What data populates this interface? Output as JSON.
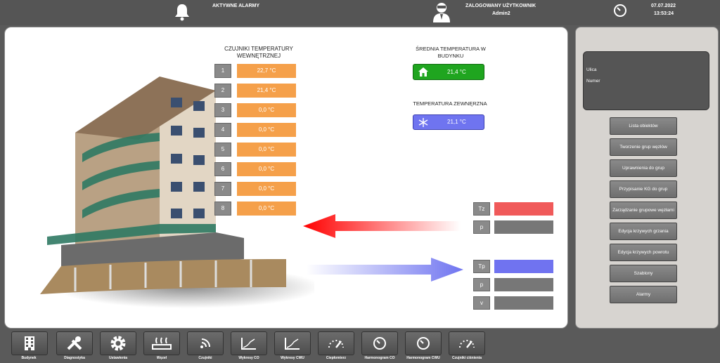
{
  "header": {
    "alarms_label": "AKTYWNE ALARMY",
    "user_title": "ZALOGOWANY UŻYTKOWNIK",
    "user_name": "Admin2",
    "date": "07.07.2022",
    "time": "13:53:24"
  },
  "sensors": {
    "title": "CZUJNIKI TEMPERATURY WEWNĘTRZNEJ",
    "items": [
      {
        "num": "1",
        "value": "22,7 °C"
      },
      {
        "num": "2",
        "value": "21,4 °C"
      },
      {
        "num": "3",
        "value": "0,0 °C"
      },
      {
        "num": "4",
        "value": "0,0 °C"
      },
      {
        "num": "5",
        "value": "0,0 °C"
      },
      {
        "num": "6",
        "value": "0,0 °C"
      },
      {
        "num": "7",
        "value": "0,0 °C"
      },
      {
        "num": "8",
        "value": "0,0 °C"
      }
    ]
  },
  "average": {
    "title": "ŚREDNIA TEMPERATURA W BUDYNKU",
    "value": "21,4 °C",
    "color": "#1fa51f"
  },
  "external": {
    "title": "TEMPERATURA ZEWNĘRZNA",
    "value": "21,1 °C",
    "color": "#6f74f0"
  },
  "supply": {
    "tz": {
      "label": "Tz",
      "color": "#f05a5a"
    },
    "p": {
      "label": "p",
      "color": "#777777"
    }
  },
  "return": {
    "tp": {
      "label": "Tp",
      "color": "#7073f0"
    },
    "p": {
      "label": "p",
      "color": "#777777"
    },
    "v": {
      "label": "v",
      "color": "#777777"
    }
  },
  "sidebar": {
    "street_label": "Ulica",
    "number_label": "Numer",
    "buttons": [
      "Lista obiektów",
      "Tworzenie grup węzłów",
      "Uprawnienia do grup",
      "Przypisanie KG do grup",
      "Zarządzanie grupowe węzłami",
      "Edycja krzywych grzania",
      "Edycja krzywych powrotu",
      "Szablony",
      "Alarmy"
    ]
  },
  "nav": [
    {
      "label": "Budynek",
      "icon": "building-icon"
    },
    {
      "label": "Diagnostyka",
      "icon": "tools-icon"
    },
    {
      "label": "Ustawienia",
      "icon": "gear-icon"
    },
    {
      "label": "Węzeł",
      "icon": "heater-icon"
    },
    {
      "label": "Czujniki",
      "icon": "sensor-icon"
    },
    {
      "label": "Wykresy CO",
      "icon": "chart-icon"
    },
    {
      "label": "Wykresy CWU",
      "icon": "chart-icon"
    },
    {
      "label": "Ciepłomierz",
      "icon": "gauge-icon"
    },
    {
      "label": "Harmonogram CO",
      "icon": "clock-icon"
    },
    {
      "label": "Harmonogram CWU",
      "icon": "clock-icon"
    },
    {
      "label": "Czujniki ciśnienia",
      "icon": "gauge-icon"
    }
  ]
}
